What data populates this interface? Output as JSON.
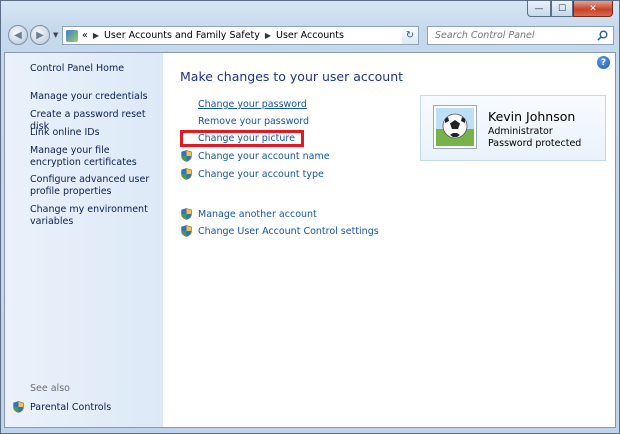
{
  "window": {
    "controls": {
      "minimize": "—",
      "maximize": "☐",
      "close": "✕"
    }
  },
  "navigation": {
    "back_glyph": "◀",
    "forward_glyph": "▶",
    "breadcrumb_prefix": "«",
    "breadcrumbs": [
      "User Accounts and Family Safety",
      "User Accounts"
    ],
    "refresh_glyph": "↻",
    "search_placeholder": "Search Control Panel"
  },
  "sidebar": {
    "home": "Control Panel Home",
    "links": [
      "Manage your credentials",
      "Create a password reset disk",
      "Link online IDs",
      "Manage your file encryption certificates",
      "Configure advanced user profile properties",
      "Change my environment variables"
    ],
    "see_also_label": "See also",
    "see_also_links": [
      "Parental Controls"
    ]
  },
  "main": {
    "heading": "Make changes to your user account",
    "help_glyph": "?",
    "tasks": [
      {
        "label": "Change your password",
        "shield": false
      },
      {
        "label": "Remove your password",
        "shield": false
      },
      {
        "label": "Change your picture",
        "shield": false,
        "highlighted": true
      },
      {
        "label": "Change your account name",
        "shield": true
      },
      {
        "label": "Change your account type",
        "shield": true
      },
      {
        "label": "Manage another account",
        "shield": true
      },
      {
        "label": "Change User Account Control settings",
        "shield": true
      }
    ]
  },
  "user": {
    "name": "Kevin Johnson",
    "role": "Administrator",
    "password_status": "Password protected",
    "picture_icon": "soccer-ball-icon"
  },
  "colors": {
    "link": "#1555a4",
    "heading": "#1e3287",
    "highlight": "#e01b24"
  }
}
